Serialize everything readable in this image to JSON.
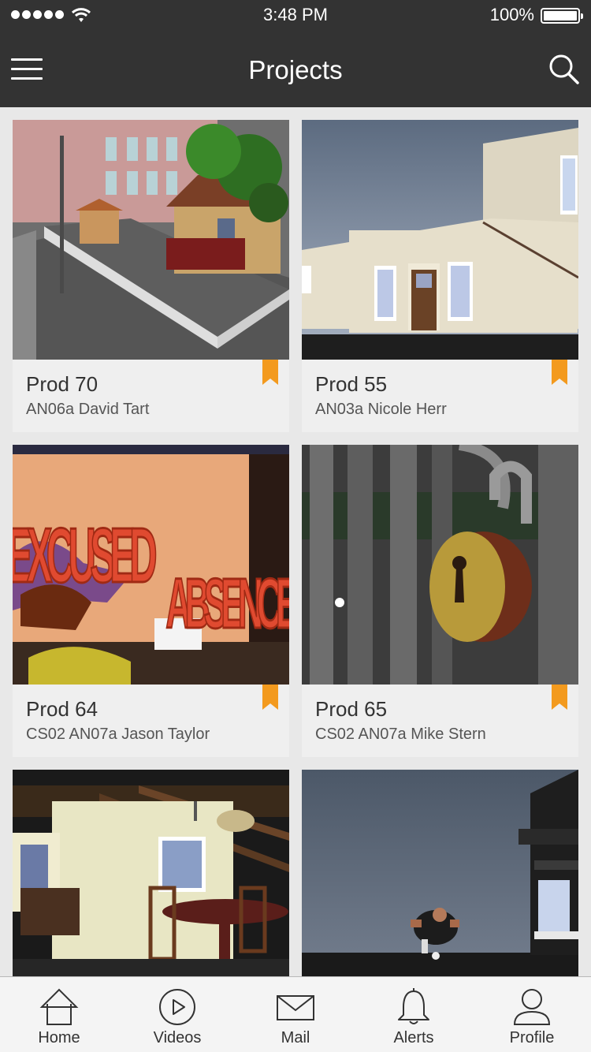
{
  "status_bar": {
    "time": "3:48 PM",
    "battery": "100%"
  },
  "nav": {
    "title": "Projects"
  },
  "projects": [
    {
      "title": "Prod 70",
      "subtitle": "AN06a David Tart",
      "bookmarked": true
    },
    {
      "title": "Prod 55",
      "subtitle": "AN03a Nicole Herr",
      "bookmarked": true
    },
    {
      "title": "Prod 64",
      "subtitle": "CS02 AN07a Jason Taylor",
      "bookmarked": true
    },
    {
      "title": "Prod 65",
      "subtitle": "CS02 AN07a Mike Stern",
      "bookmarked": true
    },
    {
      "title": "",
      "subtitle": "",
      "bookmarked": false
    },
    {
      "title": "",
      "subtitle": "",
      "bookmarked": false
    }
  ],
  "thumb_text": {
    "excused": "EXCUSED",
    "absence": "ABSENCE"
  },
  "tabs": [
    {
      "label": "Home",
      "icon": "home-icon"
    },
    {
      "label": "Videos",
      "icon": "play-icon"
    },
    {
      "label": "Mail",
      "icon": "mail-icon"
    },
    {
      "label": "Alerts",
      "icon": "bell-icon"
    },
    {
      "label": "Profile",
      "icon": "profile-icon"
    }
  ],
  "colors": {
    "bar": "#333333",
    "bookmark": "#f39a1e",
    "card": "#efefef",
    "background": "#e8e8e8"
  }
}
